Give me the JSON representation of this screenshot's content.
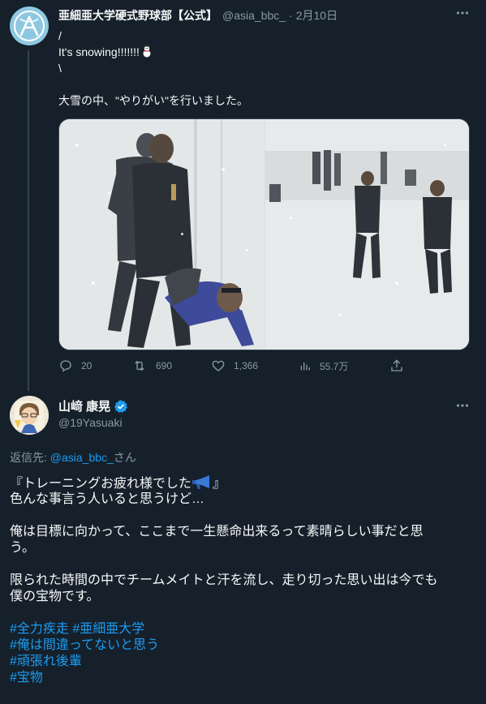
{
  "tweet1": {
    "author_name": "亜細亜大学硬式野球部【公式】",
    "author_handle": "@asia_bbc_",
    "separator": "·",
    "timestamp": "2月10日",
    "lines": [
      "/",
      "It's snowing!!!!!!!",
      "\\",
      "",
      "大雪の中、\"やりがい\"を行いました。"
    ],
    "emoji_icon": "snowman-icon",
    "avatar_icon": "team-logo",
    "media": [
      {
        "label": "photo-1"
      },
      {
        "label": "photo-2"
      }
    ],
    "actions": {
      "reply_count": "20",
      "retweet_count": "690",
      "like_count": "1,366",
      "view_count": "55.7万"
    }
  },
  "tweet2": {
    "author_name": "山﨑 康晃",
    "author_handle": "@19Yasuaki",
    "reply_prefix": "返信先: ",
    "reply_to": "@asia_bbc_",
    "reply_suffix": "さん",
    "paragraphs": {
      "p1_line1": "『トレーニングお疲れ様でした",
      "p1_line1_end": "』",
      "p1_line2": "色んな事言う人いると思うけど…",
      "p2_line1": "俺は目標に向かって、ここまで一生懸命出来るって素晴らしい事だと思",
      "p2_line2": "う。",
      "p3_line1": "限られた時間の中でチームメイトと汗を流し、走り切った思い出は今でも",
      "p3_line2": "僕の宝物です。"
    },
    "hashtags": {
      "tag1": "#全力疾走",
      "tag2": "#亜細亜大学",
      "tag3": "#俺は間違ってないと思う",
      "tag4": "#頑張れ後輩",
      "tag5": "#宝物"
    }
  },
  "colors": {
    "background": "#15202b",
    "text": "#f7f9f9",
    "secondary": "#8b98a5",
    "link": "#1d9bf0",
    "border": "#38444d"
  }
}
